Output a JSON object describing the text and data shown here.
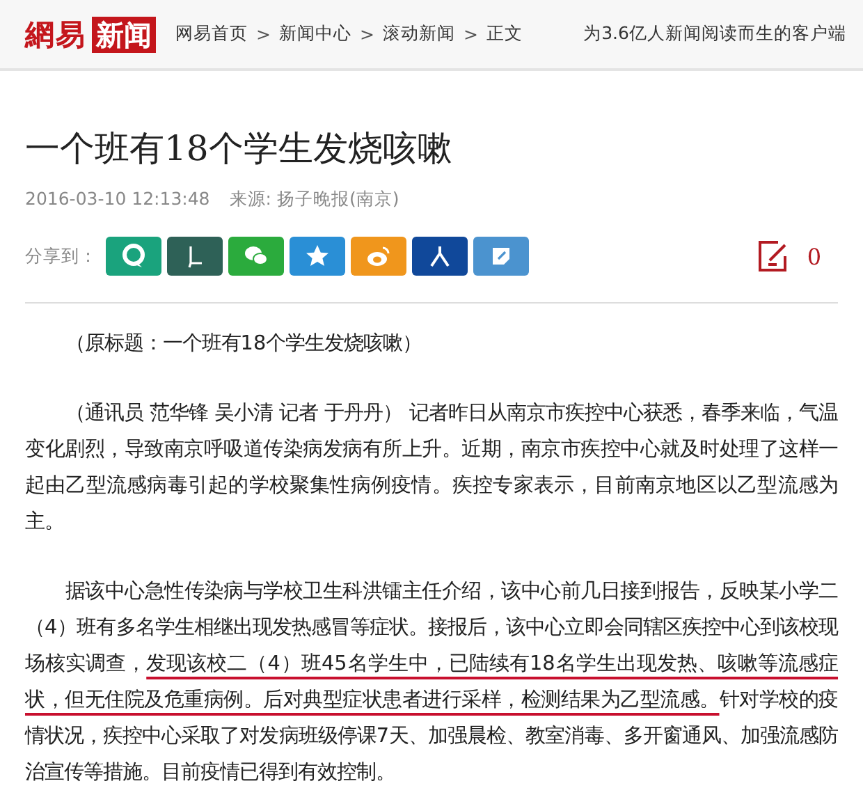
{
  "header": {
    "logo": {
      "left": "網易",
      "right": "新闻"
    },
    "breadcrumbs": [
      {
        "label": "网易首页",
        "separator": ">"
      },
      {
        "label": "新闻中心",
        "separator": ">"
      },
      {
        "label": "滚动新闻",
        "separator": ">"
      },
      {
        "label": "正文"
      }
    ],
    "tagline": "为3.6亿人新闻阅读而生的客户端"
  },
  "article": {
    "title": "一个班有18个学生发烧咳嗽",
    "date": "2016-03-10 12:13:48",
    "source": "来源: 扬子晚报(南京)",
    "share": {
      "label": "分享到：",
      "buttons": [
        {
          "kind": "bubble",
          "color": "#1aa37d"
        },
        {
          "kind": "lshape",
          "color": "#2e6157"
        },
        {
          "kind": "chat",
          "color": "#2bab3d"
        },
        {
          "kind": "star",
          "color": "#2a8fd6"
        },
        {
          "kind": "eye",
          "color": "#f0961c"
        },
        {
          "kind": "person",
          "color": "#10489a"
        },
        {
          "kind": "note",
          "color": "#4b93cf"
        }
      ]
    },
    "comments": "0",
    "paragraphs": [
      {
        "text": "（原标题：一个班有18个学生发烧咳嗽）"
      },
      {
        "text": "（通讯员  范华锋  吴小清  记者  于丹丹）  记者昨日从南京市疾控中心获悉，春季来临，气温变化剧烈，导致南京呼吸道传染病发病有所上升。近期，南京市疾控中心就及时处理了这样一起由乙型流感病毒引起的学校聚集性病例疫情。疾控专家表示，目前南京地区以乙型流感为主。"
      },
      {
        "parts": [
          {
            "text": "据该中心急性传染病与学校卫生科洪镭主任介绍，该中心前几日接到报告，反映某小学二（4）班有多名学生相继出现发热感冒等症状。接报后，该中心立即会同辖区疾控中心到该校现场核实调查，",
            "underlined": false
          },
          {
            "text": "发现该校二（4）班45名学生中，已陆续有18名学生出现发热、咳嗽等流感症状，但无住院及危重病例。后对典型症状患者进行采样，检测结果为乙型流感。",
            "underlined": true
          },
          {
            "text": "针对学校的疫情状况，疾控中心采取了对发病班级停课7天、加强晨检、教室消毒、多开窗通风、加强流感防治宣传等措施。目前疫情已得到有效控制。",
            "underlined": false
          }
        ]
      }
    ]
  }
}
